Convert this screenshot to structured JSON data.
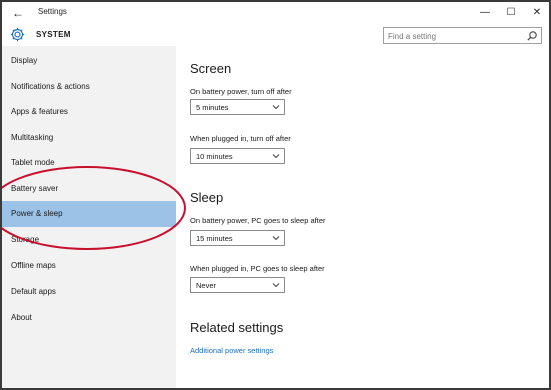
{
  "window": {
    "back": "←",
    "title": "Settings",
    "minimize": "—",
    "maximize": "☐",
    "close": "✕"
  },
  "header": {
    "section_title": "SYSTEM",
    "search_placeholder": "Find a setting"
  },
  "sidebar": {
    "items": [
      {
        "label": "Display"
      },
      {
        "label": "Notifications & actions"
      },
      {
        "label": "Apps & features"
      },
      {
        "label": "Multitasking"
      },
      {
        "label": "Tablet mode"
      },
      {
        "label": "Battery saver"
      },
      {
        "label": "Power & sleep"
      },
      {
        "label": "Storage"
      },
      {
        "label": "Offline maps"
      },
      {
        "label": "Default apps"
      },
      {
        "label": "About"
      }
    ],
    "selected": "Power & sleep"
  },
  "main": {
    "screen": {
      "heading": "Screen",
      "battery_label": "On battery power, turn off after",
      "battery_value": "5 minutes",
      "plugged_label": "When plugged in, turn off after",
      "plugged_value": "10 minutes"
    },
    "sleep": {
      "heading": "Sleep",
      "battery_label": "On battery power, PC goes to sleep after",
      "battery_value": "15 minutes",
      "plugged_label": "When plugged in, PC goes to sleep after",
      "plugged_value": "Never"
    },
    "related": {
      "heading": "Related settings",
      "link": "Additional power settings"
    }
  },
  "colors": {
    "selected_item": "#9cc3e7",
    "link": "#1a6fc4",
    "annotation": "#c8102e",
    "sidebar_bg": "#f2f2f2",
    "gear": "#1a6fc4"
  },
  "icons": {
    "gear": "gear-icon",
    "search": "search-icon",
    "chevron": "chevron-down-icon"
  }
}
